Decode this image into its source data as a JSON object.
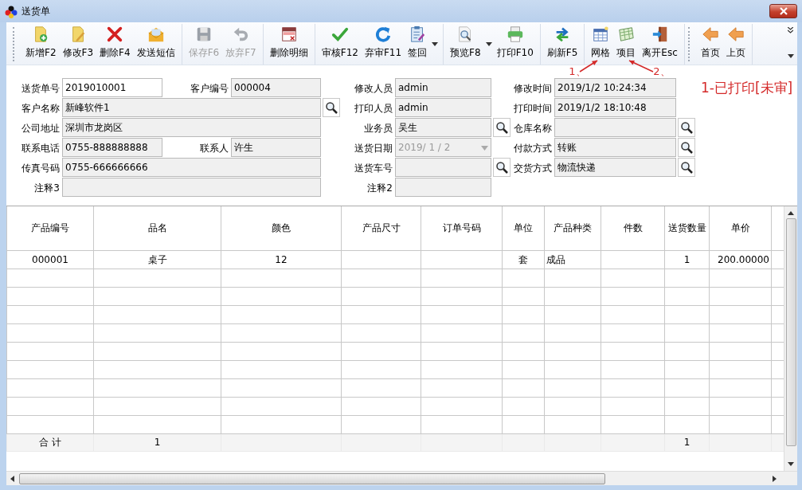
{
  "window": {
    "title": "送货单"
  },
  "toolbar": {
    "groups": [
      [
        {
          "label": "新增F2",
          "kind": "add",
          "disabled": false,
          "dropdown": false
        },
        {
          "label": "修改F3",
          "kind": "edit",
          "disabled": false,
          "dropdown": false
        },
        {
          "label": "删除F4",
          "kind": "delete",
          "disabled": false,
          "dropdown": false
        },
        {
          "label": "发送短信",
          "kind": "mail",
          "disabled": false,
          "dropdown": false
        }
      ],
      [
        {
          "label": "保存F6",
          "kind": "save",
          "disabled": true,
          "dropdown": false
        },
        {
          "label": "放弃F7",
          "kind": "undo",
          "disabled": true,
          "dropdown": false
        }
      ],
      [
        {
          "label": "删除明细",
          "kind": "delrows",
          "disabled": false,
          "dropdown": false
        }
      ],
      [
        {
          "label": "审核F12",
          "kind": "check",
          "disabled": false,
          "dropdown": false
        },
        {
          "label": "弃审F11",
          "kind": "refresh",
          "disabled": false,
          "dropdown": false
        },
        {
          "label": "签回",
          "kind": "clipboard",
          "disabled": false,
          "dropdown": true
        }
      ],
      [
        {
          "label": "预览F8",
          "kind": "preview",
          "disabled": false,
          "dropdown": true
        },
        {
          "label": "打印F10",
          "kind": "print",
          "disabled": false,
          "dropdown": false
        }
      ],
      [
        {
          "label": "刷新F5",
          "kind": "swap",
          "disabled": false,
          "dropdown": false
        }
      ],
      [
        {
          "label": "网格",
          "kind": "grid",
          "disabled": false,
          "dropdown": false
        },
        {
          "label": "项目",
          "kind": "sheet",
          "disabled": false,
          "dropdown": false
        },
        {
          "label": "离开Esc",
          "kind": "exit",
          "disabled": false,
          "dropdown": false
        }
      ],
      [
        {
          "label": "首页",
          "kind": "back",
          "disabled": false,
          "dropdown": false
        },
        {
          "label": "上页",
          "kind": "back",
          "disabled": false,
          "dropdown": false
        }
      ]
    ]
  },
  "annotations": [
    {
      "text": "1、"
    },
    {
      "text": "2、"
    }
  ],
  "form": {
    "left": [
      [
        {
          "label": "送货单号",
          "value": "2019010001",
          "readonly": false,
          "lookup": false
        },
        {
          "label": "客户编号",
          "value": "000004",
          "readonly": true,
          "lookup": false
        }
      ],
      [
        {
          "label": "客户名称",
          "value": "新峰软件1",
          "readonly": true,
          "lookup": true
        }
      ],
      [
        {
          "label": "公司地址",
          "value": "深圳市龙岗区",
          "readonly": true,
          "lookup": false
        }
      ],
      [
        {
          "label": "联系电话",
          "value": "0755-888888888",
          "readonly": true,
          "lookup": false
        },
        {
          "label": "联系人",
          "value": "许生",
          "readonly": true,
          "lookup": false
        }
      ],
      [
        {
          "label": "传真号码",
          "value": "0755-666666666",
          "readonly": true,
          "lookup": false
        }
      ],
      [
        {
          "label": "注释3",
          "readonly": true,
          "lookup": false
        }
      ]
    ],
    "middle": [
      {
        "label": "修改人员",
        "value": "admin",
        "readonly": true,
        "lookup": false,
        "kind": "text"
      },
      {
        "label": "打印人员",
        "value": "admin",
        "readonly": true,
        "lookup": false,
        "kind": "text"
      },
      {
        "label": "业务员",
        "value": "吴生",
        "readonly": true,
        "lookup": true,
        "kind": "text"
      },
      {
        "label": "送货日期",
        "value": "2019/ 1 / 2",
        "readonly": true,
        "lookup": false,
        "kind": "date",
        "disabled": true
      },
      {
        "label": "送货车号",
        "readonly": true,
        "lookup": true,
        "kind": "text"
      },
      {
        "label": "注释2",
        "readonly": true,
        "lookup": false,
        "kind": "text"
      }
    ],
    "right": [
      {
        "label": "修改时间",
        "value": "2019/1/2 10:24:34",
        "readonly": true,
        "lookup": false
      },
      {
        "label": "打印时间",
        "value": "2019/1/2 18:10:48",
        "readonly": true,
        "lookup": false
      },
      {
        "label": "仓库名称",
        "readonly": true,
        "lookup": true
      },
      {
        "label": "付款方式",
        "value": "转账",
        "readonly": true,
        "lookup": true
      },
      {
        "label": "交货方式",
        "value": "物流快递",
        "readonly": true,
        "lookup": true
      }
    ],
    "status": "1-已打印[未审]"
  },
  "table": {
    "columns": [
      "产品编号",
      "品名",
      "颜色",
      "产品尺寸",
      "订单号码",
      "单位",
      "产品种类",
      "件数",
      "送货数量",
      "单价",
      ""
    ],
    "rows": [
      [
        "000001",
        "桌子",
        "12",
        "",
        "",
        "套",
        "成品",
        "",
        "1",
        "200.00000",
        ""
      ]
    ],
    "totals": {
      "column_1": "合 计",
      "column_2": "1",
      "column_9": "1"
    }
  }
}
